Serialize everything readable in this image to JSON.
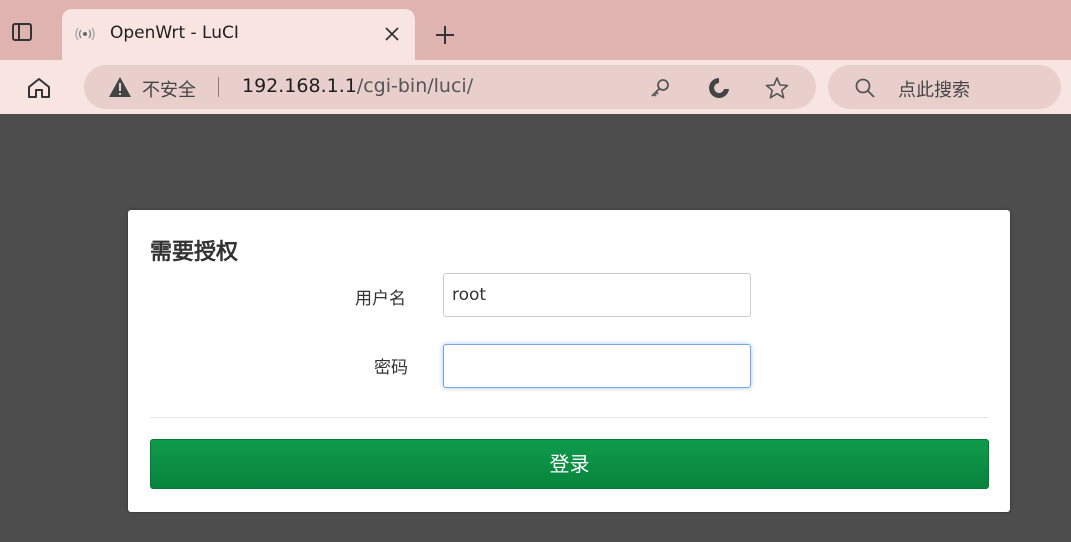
{
  "browser": {
    "tab": {
      "title": "OpenWrt - LuCI"
    },
    "address": {
      "security_label": "不安全",
      "url_host": "192.168.1.1",
      "url_path": "/cgi-bin/luci/"
    },
    "search": {
      "placeholder": "点此搜索"
    },
    "icons": [
      "tab-actions-icon",
      "wireless-favicon-icon",
      "close-icon",
      "plus-icon",
      "home-icon",
      "warning-icon",
      "key-icon",
      "edge-refresh-icon",
      "star-icon",
      "search-icon"
    ]
  },
  "login": {
    "heading": "需要授权",
    "username_label": "用户名",
    "username_value": "root",
    "password_label": "密码",
    "password_value": "",
    "submit_label": "登录"
  },
  "colors": {
    "tab_strip": "#dfb3af",
    "toolbar": "#f8e4e1",
    "page_background": "#4d4d4d",
    "login_button": "#0a8f43"
  }
}
